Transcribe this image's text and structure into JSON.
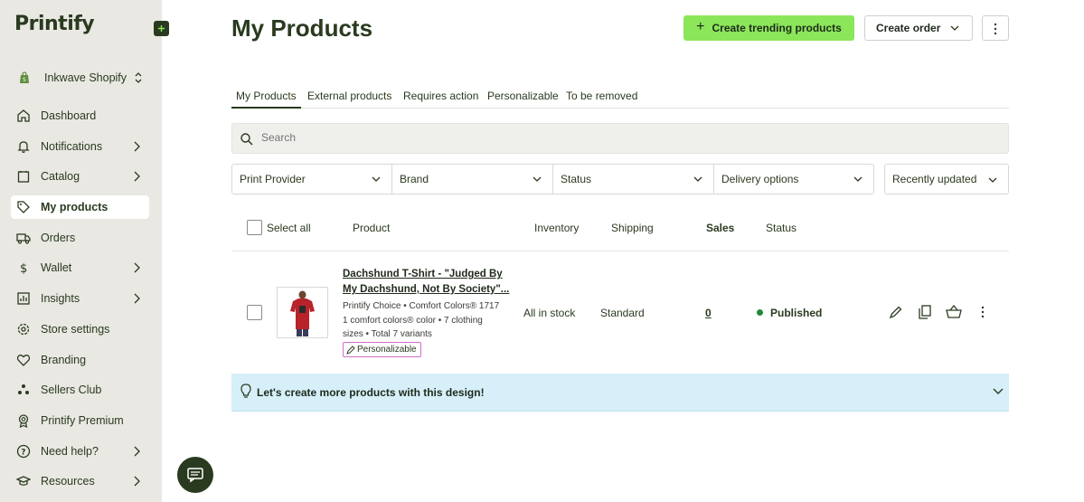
{
  "brand": {
    "logo_text": "Printify"
  },
  "sidebar": {
    "store": {
      "label": "Inkwave Shopify"
    },
    "items": [
      {
        "label": "Dashboard",
        "icon": "home-icon",
        "chevron": false
      },
      {
        "label": "Notifications",
        "icon": "bell-icon",
        "chevron": true
      },
      {
        "label": "Catalog",
        "icon": "catalog-icon",
        "chevron": true
      },
      {
        "label": "My products",
        "icon": "tag-icon",
        "chevron": false,
        "active": true
      },
      {
        "label": "Orders",
        "icon": "truck-icon",
        "chevron": false
      },
      {
        "label": "Wallet",
        "icon": "dollar-icon",
        "chevron": true
      },
      {
        "label": "Insights",
        "icon": "chart-icon",
        "chevron": true
      },
      {
        "label": "Store settings",
        "icon": "gear-icon",
        "chevron": false
      },
      {
        "label": "Branding",
        "icon": "heart-icon",
        "chevron": false
      },
      {
        "label": "Sellers Club",
        "icon": "dots-icon",
        "chevron": false
      },
      {
        "label": "Printify Premium",
        "icon": "badge-icon",
        "chevron": false
      },
      {
        "label": "Need help?",
        "icon": "help-icon",
        "chevron": true
      },
      {
        "label": "Resources",
        "icon": "graduation-icon",
        "chevron": true
      }
    ]
  },
  "header": {
    "title": "My Products",
    "create_trending_label": "Create trending products",
    "create_order_label": "Create order"
  },
  "tabs": [
    "My Products",
    "External products",
    "Requires action",
    "Personalizable",
    "To be removed"
  ],
  "search": {
    "placeholder": "Search"
  },
  "filters": [
    "Print Provider",
    "Brand",
    "Status",
    "Delivery options"
  ],
  "sort": {
    "label": "Recently updated"
  },
  "table": {
    "select_all_label": "Select all",
    "columns": {
      "product": "Product",
      "inventory": "Inventory",
      "shipping": "Shipping",
      "sales": "Sales",
      "status": "Status"
    },
    "rows": [
      {
        "title": "Dachshund T-Shirt - \"Judged By My Dachshund, Not By Society\"...",
        "provider_line": "Printify Choice • Comfort Colors® 1717",
        "variants_line": "1 comfort colors® color • 7 clothing sizes • Total 7 variants",
        "badge": "Personalizable",
        "inventory": "All in stock",
        "shipping": "Standard",
        "sales": "0",
        "status": "Published",
        "status_color": "#1f8a3a"
      }
    ]
  },
  "banner": {
    "text": "Let's create more products with this design!"
  },
  "colors": {
    "accent_green": "#8be65a",
    "brand_dark": "#2a3a1f",
    "sidebar_bg": "#e9e8e3",
    "banner_bg": "#d6eff8"
  }
}
